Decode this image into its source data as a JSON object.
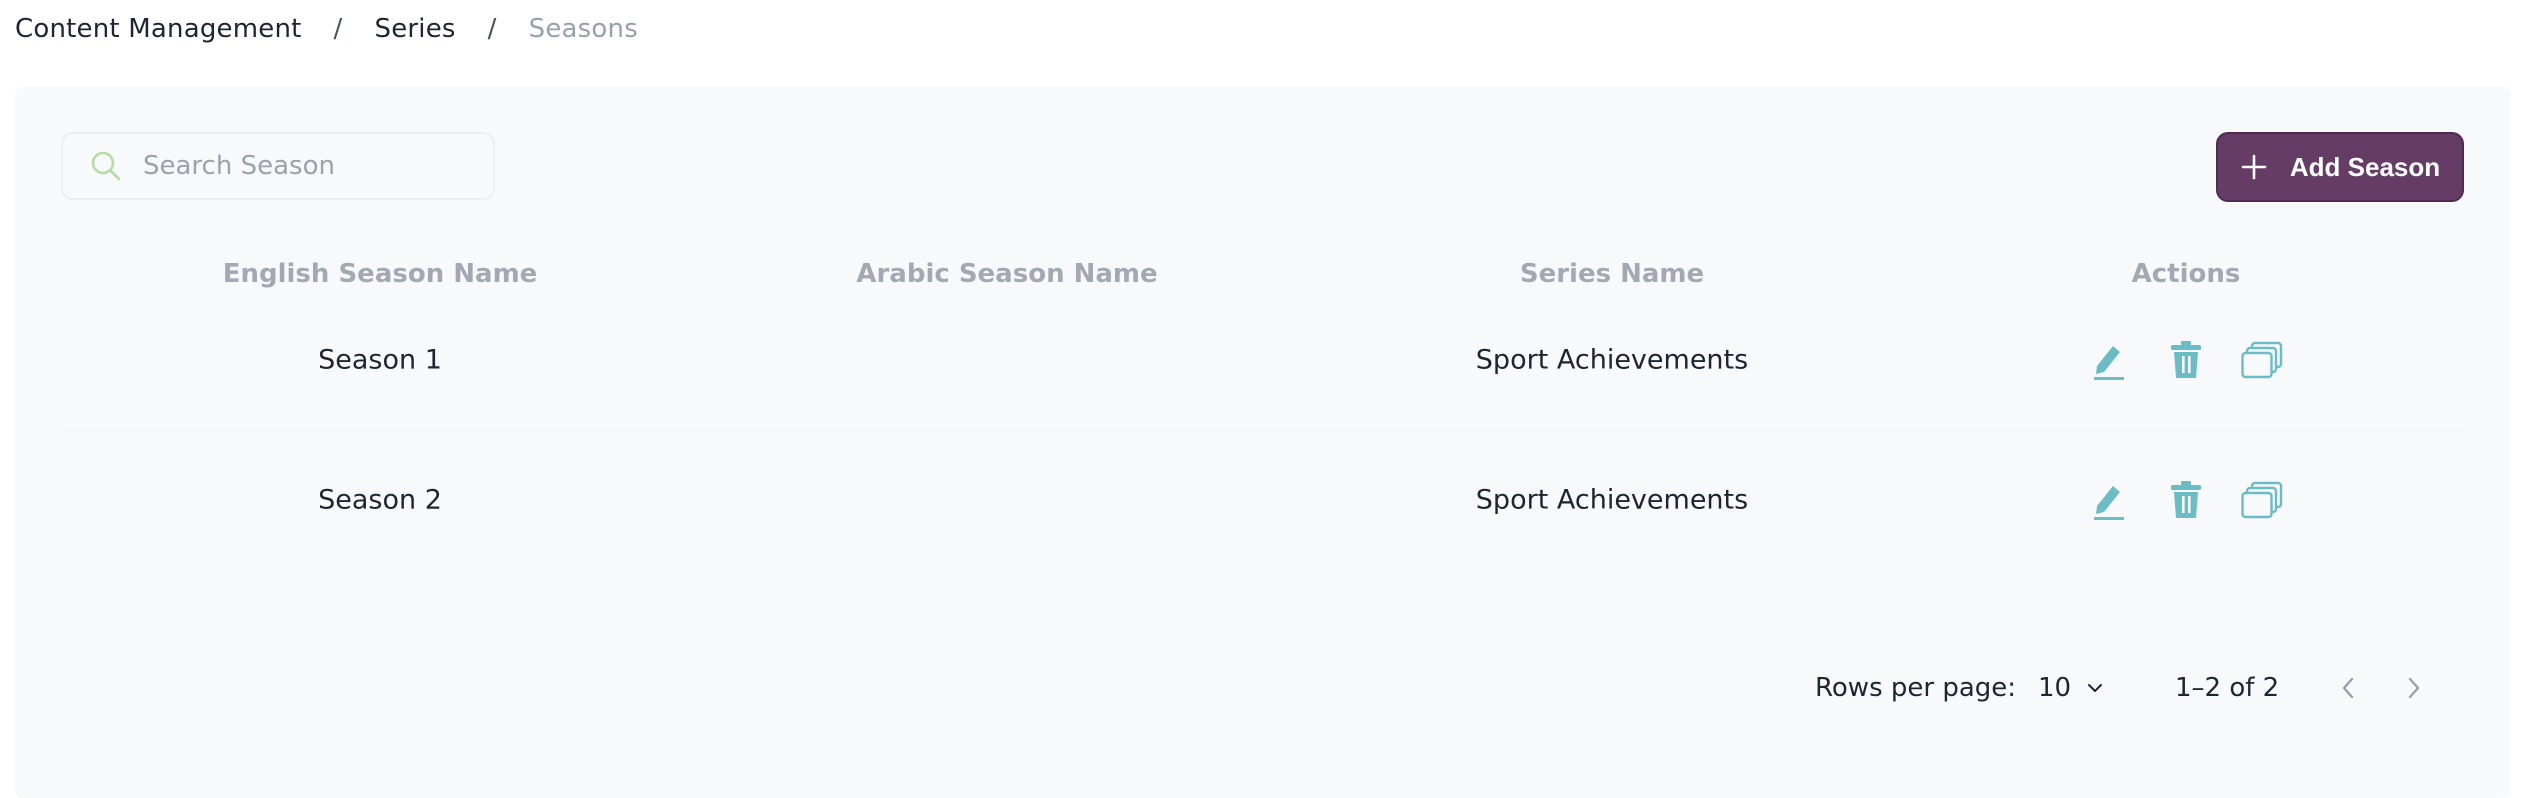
{
  "breadcrumb": {
    "items": [
      "Content Management",
      "Series",
      "Seasons"
    ],
    "separator": "/"
  },
  "search": {
    "placeholder": "Search Season",
    "value": ""
  },
  "toolbar": {
    "add_label": "Add Season"
  },
  "table": {
    "columns": [
      "English Season Name",
      "Arabic Season Name",
      "Series Name",
      "Actions"
    ],
    "rows": [
      {
        "english_name": "Season 1",
        "arabic_name": "",
        "series_name": "Sport Achievements"
      },
      {
        "english_name": "Season 2",
        "arabic_name": "",
        "series_name": "Sport Achievements"
      }
    ]
  },
  "pagination": {
    "rows_per_page_label": "Rows per page:",
    "rows_per_page_value": "10",
    "range_label": "1–2 of 2"
  },
  "icons": {
    "search": "search-icon",
    "add": "plus-icon",
    "edit": "pencil-icon",
    "delete": "trash-icon",
    "copy": "copy-icon",
    "dropdown": "chevron-down-icon",
    "prev": "chevron-left-icon",
    "next": "chevron-right-icon"
  },
  "colors": {
    "primary_button": "#653c66",
    "action_icon": "#6cbcc6",
    "search_icon": "#b7dba6",
    "muted_text": "#a3a8b3",
    "panel_background": "#f8f9fb"
  }
}
